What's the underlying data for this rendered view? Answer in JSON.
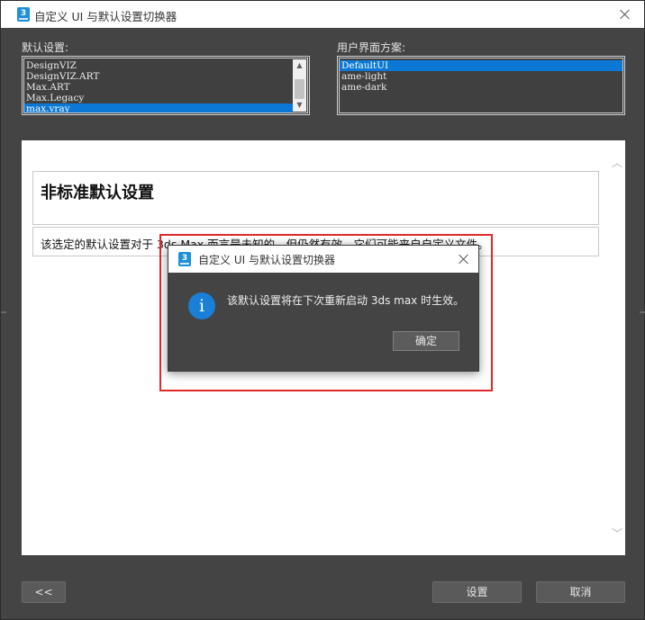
{
  "window": {
    "title": "自定义 UI 与默认设置切换器",
    "app_icon_text": "3"
  },
  "defaults": {
    "label": "默认设置:",
    "items": [
      "DesignVIZ",
      "DesignVIZ.ART",
      "Max.ART",
      "Max.Legacy",
      "max.vray"
    ],
    "selected": "max.vray"
  },
  "schemes": {
    "label": "用户界面方案:",
    "items": [
      "DefaultUI",
      "ame-light",
      "ame-dark"
    ],
    "selected": "DefaultUI"
  },
  "content": {
    "heading": "非标准默认设置",
    "description": "该选定的默认设置对于 3ds Max 而言是未知的，但仍然有效。它们可能来自自定义文件。"
  },
  "buttons": {
    "back": "<<",
    "set": "设置",
    "cancel": "取消"
  },
  "dialog": {
    "title": "自定义 UI 与默认设置切换器",
    "message": "该默认设置将在下次重新启动 3ds max 时生效。",
    "ok": "确定",
    "icon_glyph": "i"
  },
  "colors": {
    "accent": "#0a78d4",
    "highlight": "#e02a2a",
    "window_bg": "#444444"
  }
}
